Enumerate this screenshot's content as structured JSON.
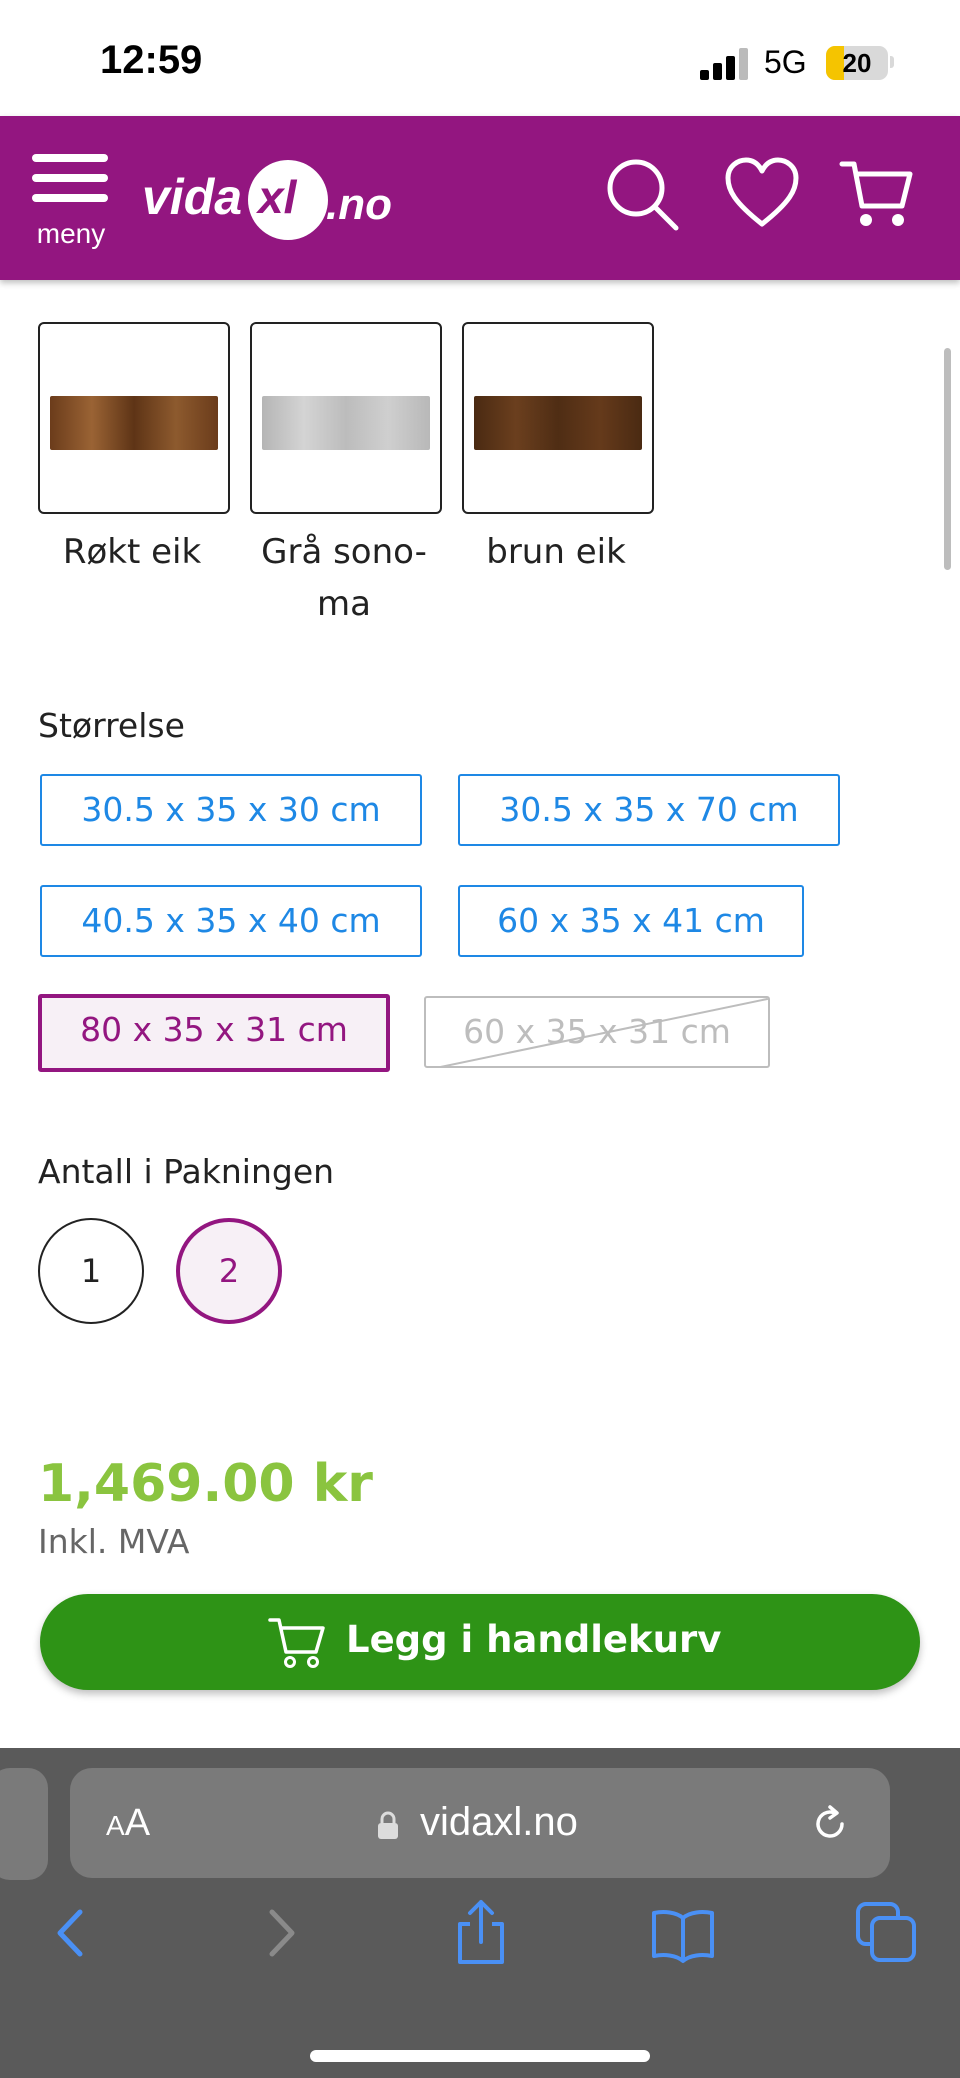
{
  "status_bar": {
    "time": "12:59",
    "network": "5G",
    "battery": "20"
  },
  "header": {
    "menu_label": "meny",
    "logo_part1": "vida",
    "logo_part2": "xl",
    "logo_part3": ".no"
  },
  "color_options": [
    {
      "label": "Røkt eik",
      "color": "#7a4a22"
    },
    {
      "label": "Grå sono-",
      "label_line2": "ma",
      "color": "#c4c4c4"
    },
    {
      "label": "brun eik",
      "color": "#5a3418"
    }
  ],
  "size_section": {
    "title": "Størrelse",
    "options": [
      "30.5 x 35 x 30 cm",
      "30.5 x 35 x 70 cm",
      "40.5 x 35 x 40 cm",
      "60 x 35 x 41 cm",
      "80 x 35 x 31 cm",
      "60 x 35 x 31 cm"
    ],
    "selected": "80 x 35 x 31 cm",
    "unavailable": "60 x 35 x 31 cm"
  },
  "quantity_section": {
    "title": "Antall i Pakningen",
    "options": [
      "1",
      "2"
    ],
    "selected": "2"
  },
  "price": {
    "amount": "1,469.00 kr",
    "vat_note": "Inkl. MVA"
  },
  "add_to_cart": {
    "label": "Legg i handlekurv"
  },
  "browser": {
    "text_size_label_small": "A",
    "text_size_label_large": "A",
    "url": "vidaxl.no"
  },
  "colors": {
    "brand": "#931680",
    "price": "#8ac43f",
    "cta": "#2e9316",
    "link": "#1e88e5"
  }
}
